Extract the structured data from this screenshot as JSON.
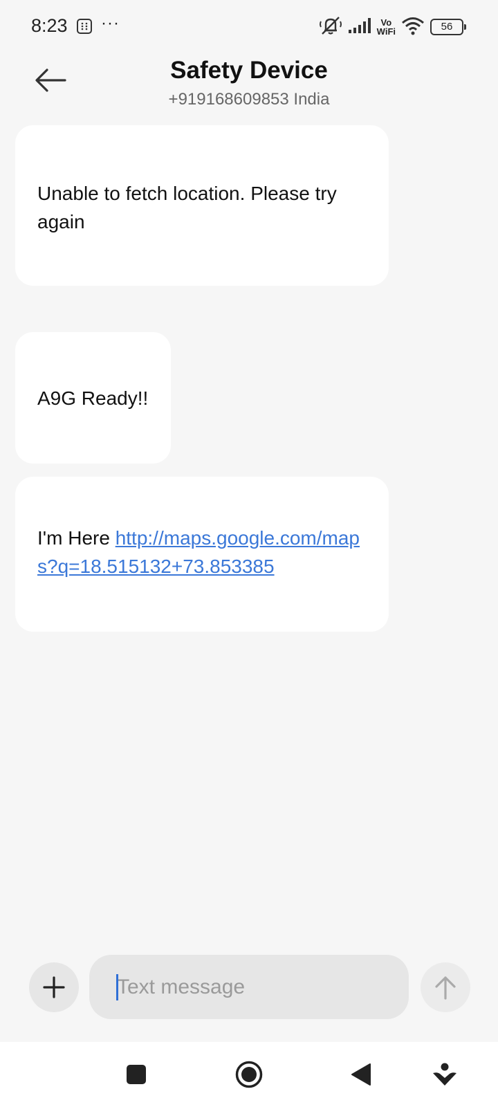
{
  "status_bar": {
    "time": "8:23",
    "more": "···",
    "vowifi_top": "Vo",
    "vowifi_bottom": "WiFi",
    "battery": "56"
  },
  "header": {
    "contact_name": "Safety Device",
    "contact_number": "+919168609853 India"
  },
  "messages": [
    {
      "text": "Unable to fetch location. Please try again"
    },
    {
      "text": "A9G Ready!!"
    },
    {
      "text": "I'm Here ",
      "link": "http://maps.google.com/maps?q=18.515132+73.853385"
    }
  ],
  "compose": {
    "placeholder": "Text message"
  },
  "icons": {
    "back": "arrow-left-icon",
    "add": "plus-icon",
    "send": "arrow-up-icon",
    "nav_recents": "square-icon",
    "nav_home": "circle-icon",
    "nav_back": "triangle-icon",
    "nav_assist": "person-icon"
  },
  "colors": {
    "background": "#f6f6f6",
    "bubble": "#ffffff",
    "link": "#3b78d8",
    "caret": "#2f6fd6"
  }
}
